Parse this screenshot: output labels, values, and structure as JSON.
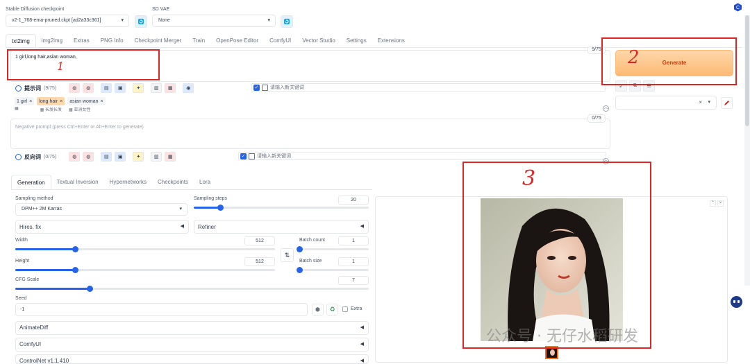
{
  "header": {
    "checkpoint_label": "Stable Diffusion checkpoint",
    "checkpoint_value": "v2-1_768-ema-pruned.ckpt [ad2a33c361]",
    "vae_label": "SD VAE",
    "vae_value": "None"
  },
  "main_tabs": [
    "txt2img",
    "img2img",
    "Extras",
    "PNG Info",
    "Checkpoint Merger",
    "Train",
    "OpenPose Editor",
    "ComfyUI",
    "Vector Studio",
    "Settings",
    "Extensions"
  ],
  "prompt": {
    "text": "1 girl,long hair,asian woman,",
    "counter": "9/75",
    "bar_title": "提示词",
    "bar_count": "(9/75)",
    "keyword_placeholder": "请输入新关键词",
    "chips": [
      "1 girl",
      "long hair",
      "asian woman"
    ],
    "chip_close": "×",
    "chip_sub_1": "长发长发",
    "chip_sub_2": "亚洲女性"
  },
  "negative": {
    "placeholder": "Negative prompt (press Ctrl+Enter or Alt+Enter to generate)",
    "counter": "0/75",
    "bar_title": "反向词",
    "bar_count": "(0/75)",
    "keyword_placeholder": "请输入新关键词"
  },
  "generate": {
    "label": "Generate"
  },
  "style_select": {
    "clear": "×",
    "caret": "▾"
  },
  "sub_tabs": [
    "Generation",
    "Textual Inversion",
    "Hypernetworks",
    "Checkpoints",
    "Lora"
  ],
  "params": {
    "sampling_method_label": "Sampling method",
    "sampling_method_value": "DPM++ 2M Karras",
    "sampling_steps_label": "Sampling steps",
    "sampling_steps_value": "20",
    "sampling_steps_fraction": 0.15,
    "hires_label": "Hires. fix",
    "refiner_label": "Refiner",
    "width_label": "Width",
    "width_value": "512",
    "width_fraction": 0.23,
    "height_label": "Height",
    "height_value": "512",
    "height_fraction": 0.23,
    "batch_count_label": "Batch count",
    "batch_count_value": "1",
    "batch_size_label": "Batch size",
    "batch_size_value": "1",
    "cfg_label": "CFG Scale",
    "cfg_value": "7",
    "cfg_fraction": 0.21,
    "seed_label": "Seed",
    "seed_value": "-1",
    "extra_label": "Extra",
    "swap_glyph": "⇅",
    "collapse_glyph": "◀"
  },
  "accordions": [
    "AnimateDiff",
    "ComfyUI",
    "ControlNet v1.1.410"
  ],
  "annotations": {
    "one": "1",
    "two": "2",
    "three": "3"
  },
  "watermark": "公众号 · 无仔水稻研发",
  "colors": {
    "accent": "#2563eb",
    "generate_bg": "#fed7aa",
    "generate_text": "#c2410c",
    "annotation": "#dc2626"
  }
}
